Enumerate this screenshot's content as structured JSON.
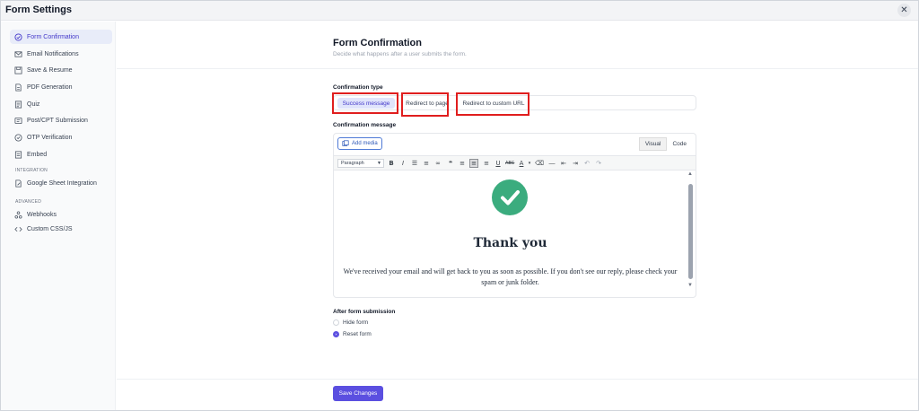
{
  "window": {
    "title": "Form Settings",
    "close_icon": "close-icon"
  },
  "sidebar": {
    "items": [
      {
        "label": "Form Confirmation",
        "icon": "check-circle-icon",
        "active": true
      },
      {
        "label": "Email Notifications",
        "icon": "mail-icon"
      },
      {
        "label": "Save & Resume",
        "icon": "save-icon"
      },
      {
        "label": "PDF Generation",
        "icon": "document-icon"
      },
      {
        "label": "Quiz",
        "icon": "quiz-icon"
      },
      {
        "label": "Post/CPT Submission",
        "icon": "post-icon"
      },
      {
        "label": "OTP Verification",
        "icon": "shield-icon"
      },
      {
        "label": "Embed",
        "icon": "embed-icon"
      }
    ],
    "integration_heading": "INTEGRATION",
    "integration_items": [
      {
        "label": "Google Sheet Integration",
        "icon": "sheet-icon"
      }
    ],
    "advanced_heading": "ADVANCED",
    "advanced_items": [
      {
        "label": "Webhooks",
        "icon": "webhook-icon"
      },
      {
        "label": "Custom CSS/JS",
        "icon": "code-icon"
      }
    ]
  },
  "main": {
    "title": "Form Confirmation",
    "subtitle": "Decide what happens after a user submits the form.",
    "confirmation_type_label": "Confirmation type",
    "confirmation_types": [
      {
        "label": "Success message",
        "selected": true
      },
      {
        "label": "Redirect to page"
      },
      {
        "label": "Redirect to custom URL"
      }
    ],
    "confirmation_message_label": "Confirmation message",
    "editor": {
      "add_media": "Add media",
      "tabs": [
        {
          "label": "Visual",
          "active": true
        },
        {
          "label": "Code"
        }
      ],
      "format_select": "Paragraph",
      "content": {
        "heading": "Thank you",
        "message": "We've received your email and will get back to you as soon as possible. If you don't see our reply, please check your spam or junk folder."
      }
    },
    "after_submission_label": "After form submission",
    "after_submission_options": [
      {
        "label": "Hide form",
        "checked": false
      },
      {
        "label": "Reset form",
        "checked": true
      }
    ],
    "save_button": "Save Changes"
  },
  "colors": {
    "accent": "#5b4fe0",
    "success_green": "#3bac7e",
    "highlight_red": "#e01e1e"
  }
}
